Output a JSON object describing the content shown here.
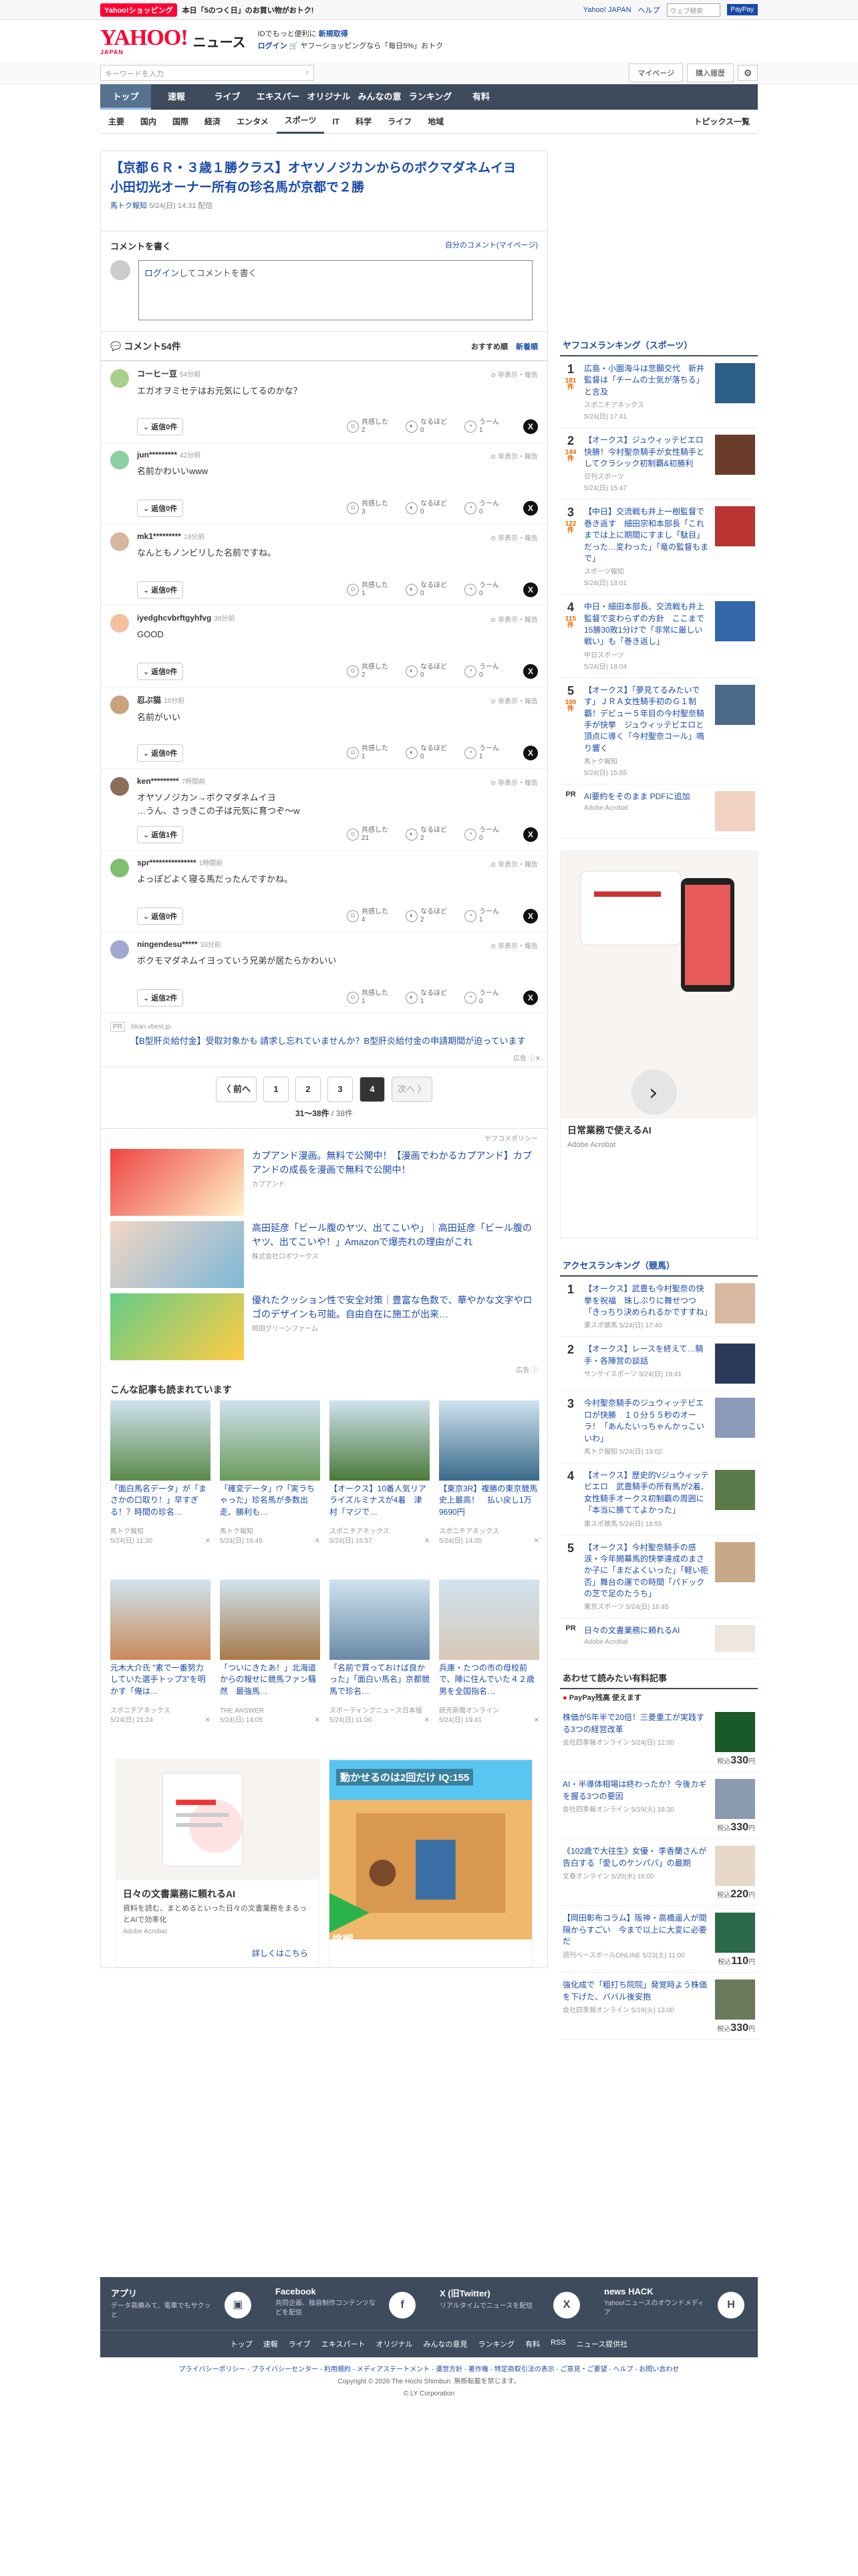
{
  "topbar": {
    "badge": "Yahoo!ショッピング",
    "promo": "本日「5のつく日」のお買い物がおトク!",
    "links": [
      "Yahoo! JAPAN",
      "ヘルプ"
    ],
    "search_placeholder": "ウェブ検索",
    "search_btn": "PayPay"
  },
  "header": {
    "logo": "YAHOO!",
    "logo_sub": "JAPAN",
    "news": "ニュース",
    "msg1": "IDでもっと便利に",
    "msg1b": "新規取得",
    "msg2a": "ログイン",
    "msg2": "ヤフーショッピングなら「毎日5%」おトク"
  },
  "search": {
    "placeholder": "キーワードを入力",
    "mypage": "マイページ",
    "history": "購入履歴"
  },
  "nav": [
    "トップ",
    "速報",
    "ライブ",
    "エキスパート",
    "オリジナル",
    "みんなの意見",
    "ランキング",
    "有料"
  ],
  "subnav": [
    "主要",
    "国内",
    "国際",
    "経済",
    "エンタメ",
    "スポーツ",
    "IT",
    "科学",
    "ライフ",
    "地域"
  ],
  "subnav_right": "トピックス一覧",
  "article": {
    "title": "【京都６Ｒ・３歳１勝クラス】オヤソノジカンからのボクマダネムイヨ　小田切光オーナー所有の珍名馬が京都で２勝",
    "source": "馬トク報知",
    "time": "5/24(日) 14:31 配信"
  },
  "comment_write": {
    "title": "コメントを書く",
    "mycomments": "自分のコメント(マイページ)",
    "login": "ログイン",
    "prompt": "してコメントを書く"
  },
  "comments_head": {
    "title": "コメント54件",
    "sort1": "おすすめ順",
    "sort2": "新着順"
  },
  "comments": [
    {
      "name": "コーヒー豆",
      "time": "54分前",
      "text": "エガオヲミセテはお元気にしてるのかな？",
      "reply": "返信0件",
      "c1": "2",
      "c2": "0",
      "c3": "1",
      "av": "#a7d08c"
    },
    {
      "name": "jun*********",
      "time": "42分前",
      "text": "名前かわいいwww",
      "reply": "返信0件",
      "c1": "3",
      "c2": "0",
      "c3": "0",
      "av": "#8ccfa0"
    },
    {
      "name": "mk1*********",
      "time": "19分前",
      "text": "なんともノンビリした名前ですね。",
      "reply": "返信0件",
      "c1": "1",
      "c2": "0",
      "c3": "0",
      "av": "#d6b6a0"
    },
    {
      "name": "iyedghcvbrftgyhfvg",
      "time": "39分前",
      "text": "GOOD",
      "reply": "返信0件",
      "c1": "2",
      "c2": "0",
      "c3": "0",
      "av": "#f2c1a0"
    },
    {
      "name": "忍ぶ猫",
      "time": "16分前",
      "text": "名前がいい",
      "reply": "返信0件",
      "c1": "1",
      "c2": "0",
      "c3": "1",
      "av": "#c9a27e"
    },
    {
      "name": "ken*********",
      "time": "7時間前",
      "text": "オヤソノジカン→ボクマダネムイヨ\n…うん、さっきこの子は元気に育つぞ〜w",
      "reply": "返信1件",
      "c1": "21",
      "c2": "2",
      "c3": "0",
      "av": "#8a6f5a"
    },
    {
      "name": "spr***************",
      "time": "1時間前",
      "text": "よっぽどよく寝る馬だったんですかね。",
      "reply": "返信0件",
      "c1": "4",
      "c2": "2",
      "c3": "1",
      "av": "#7fbf6f"
    },
    {
      "name": "ningendesu*****",
      "time": "33分前",
      "text": "ボクモマダネムイヨっていう兄弟が居たらかわいい",
      "reply": "返信2件",
      "c1": "1",
      "c2": "1",
      "c3": "0",
      "av": "#a0a8d0"
    }
  ],
  "comment_labels": {
    "report": "非表示・報告",
    "k1": "共感した",
    "k2": "なるほど",
    "k3": "うーん"
  },
  "pr": {
    "tag": "PR",
    "src": "bkan.vbest.jp",
    "text": "【B型肝炎給付金】受取対象かも 請求し忘れていませんか？B型肝炎給付金の申請期間が迫っています",
    "adinfo": "広告"
  },
  "pager": {
    "prev": "〈 前へ",
    "pages": [
      "1",
      "2",
      "3",
      "4"
    ],
    "current": "4",
    "next": "次へ 〉",
    "info": "31〜38件",
    "total": "/ 38件"
  },
  "policy": "ヤフコメポリシー",
  "ads": [
    {
      "title": "カプアンド漫画。無料で公開中！【漫画でわかるカプアンド】カプアンドの成長を漫画で無料で公開中！",
      "src": "カプアンド"
    },
    {
      "title": "高田延彦「ビール腹のヤツ、出てこいや」｜高田延彦「ビール腹のヤツ、出てこいや！」Amazonで爆売れの理由がこれ",
      "src": "株式会社ロボワークス"
    },
    {
      "title": "優れたクッション性で安全対策｜豊富な色数で、華やかな文字やロゴのデザインも可能。自由自在に施工が出来…",
      "src": "岡田グリーンファーム"
    }
  ],
  "ads_info": "広告",
  "also_read": {
    "title": "こんな記事も読まれています",
    "items": [
      {
        "title": "「面白馬名データ」が「まさかの口取り！」早すぎる！？時間の珍名…",
        "src": "馬トク報知",
        "time": "5/24(日) 11:30"
      },
      {
        "title": "「確変データ」!?「実ラちゃった」珍名馬が多数出走、勝利も…",
        "src": "馬トク報知",
        "time": "5/24(日) 16:45"
      },
      {
        "title": "【オークス】10番人気リアライズルミナスが4着　津村「マジで…",
        "src": "スポニチアネックス",
        "time": "5/24(日) 16:57"
      },
      {
        "title": "【東京3R】複勝の東京競馬史上最高！　払い戻し1万9690円",
        "src": "スポニチアネックス",
        "time": "5/24(日) 14:35"
      },
      {
        "title": "元木大介氏 \"素で一番努力していた選手トップ3\"を明かす「俺は…",
        "src": "スポニチアネックス",
        "time": "5/24(日) 21:24"
      },
      {
        "title": "「ついにきたあ！」北海道からの報せに競馬ファン騒然　最強馬…",
        "src": "THE ANSWER",
        "time": "5/24(日) 14:05"
      },
      {
        "title": "「名前で買っておけば良かった」「面白い馬名」京都競馬で珍名…",
        "src": "スポーティングニュース日本版",
        "time": "5/24(日) 11:00"
      },
      {
        "title": "兵庫・たつの市の母校前で、陣に住んでいた４２歳男を全国指名…",
        "src": "読売新聞オンライン",
        "time": "5/24(日) 19:41"
      }
    ]
  },
  "bottom_ads": [
    {
      "title": "日々の文書業務に頼れるAI",
      "desc": "資料を読む、まとめるといった日々の文書業務をまるっとAIで効率化",
      "src": "Adobe Acrobat",
      "link": "詳しくはこちら"
    },
    {
      "title": "動かせるのは2回だけ IQ:155",
      "badge": "挑戦"
    }
  ],
  "sidebar": {
    "ranking_title": "ヤフコメランキング（スポーツ）",
    "ranking": [
      {
        "n": "1",
        "c": "181",
        "title": "広島・小園海斗は悲願交代　新井監督は「チームの士気が落ちる」と言及",
        "src": "スポニチアネックス",
        "time": "5/24(日) 17:41"
      },
      {
        "n": "2",
        "c": "144",
        "title": "【オークス】ジュウィッテビエロ快勝！今村聖奈騎手が女性騎手としてクラシック初制覇&初勝利",
        "src": "日刊スポーツ",
        "time": "5/24(日) 15:47"
      },
      {
        "n": "3",
        "c": "122",
        "title": "【中日】交流戦も井上一樹監督で巻き返す　細田宗和本部長「これまでは上に期間にすまし「駄目」だった…変わった」「竜の監督もまで」",
        "src": "スポーツ報知",
        "time": "5/24(日) 18:01"
      },
      {
        "n": "4",
        "c": "115",
        "title": "中日・細田本部長、交流戦も井上監督で変わらずの方針　ここまで15勝30敗1分けで「非常に厳しい戦い」も「巻き返し」",
        "src": "中日スポーツ",
        "time": "5/24(日) 18:04"
      },
      {
        "n": "5",
        "c": "100",
        "title": "【オークス】「夢見てるみたいです」ＪＲＡ女性騎手初のＧ１制覇！デビュー５年目の今村聖奈騎手が快挙　ジュウィッテビエロと頂点に導く「今村聖奈コール」鳴り響く",
        "src": "馬トク報知",
        "time": "5/24(日) 15:55"
      }
    ],
    "ranking_pr": {
      "tag": "PR",
      "title": "AI要約をそのまま PDFに追加",
      "src": "Adobe Acrobat"
    },
    "side_ad": {
      "title": "日常業務で使えるAI",
      "src": "Adobe Acrobat"
    },
    "access_title": "アクセスランキング（競馬）",
    "access": [
      {
        "n": "1",
        "title": "【オークス】武豊も今村聖奈の快挙を祝福　珠しぶりに舞せつつ「きっちり決められるかですすね」",
        "src": "東スポ競馬",
        "time": "5/24(日) 17:40"
      },
      {
        "n": "2",
        "title": "【オークス】レースを終えて…騎手・各陣営の談話",
        "src": "サンケイスポーツ",
        "time": "5/24(日) 19:41"
      },
      {
        "n": "3",
        "title": "今村聖奈騎手のジュウィッテビエロが快勝　１０分５５秒のオーラ！「あんたいっちゃんかっこいいわ」",
        "src": "馬トク報知",
        "time": "5/24(日) 19:02"
      },
      {
        "n": "4",
        "title": "【オークス】歴史的Vジュウィッテビエロ　武豊騎手の所有馬が2着、女性騎手オークス初制覇の周囲に「本当に勝ててよかった」",
        "src": "東スポ競馬",
        "time": "5/24(日) 18:55"
      },
      {
        "n": "5",
        "title": "【オークス】今村聖奈騎手の感涙・今年開幕馬的快挙達成のまさか子に「まだよくいった」「軽い拒否」舞台の運での時間「パドックの芝で足のたうち」",
        "src": "東京スポーツ",
        "time": "5/24(日) 16:45"
      }
    ],
    "access_pr": {
      "tag": "PR",
      "title": "日々の文書業務に頼れるAI",
      "src": "Adobe Acrobat"
    },
    "paid_title": "あわせて読みたい有料記事",
    "paid_sub": "PayPay残高 使えます",
    "paid": [
      {
        "title": "株価が5年半で20倍！三菱重工が実践する3つの経営改革",
        "src": "会社四季報オンライン",
        "time": "5/24(日) 12:00",
        "price": "330"
      },
      {
        "title": "AI・半導体相場は終わったか？今後カギを握る3つの要因",
        "src": "会社四季報オンライン",
        "time": "5/19(火) 18:30",
        "price": "330"
      },
      {
        "title": "《102歳で大往生》女優・ 李香蘭さんが告白する「愛しのケンパパ」の最期",
        "src": "文春オンライン",
        "time": "5/20(水) 16:00",
        "price": "220"
      },
      {
        "title": "【岡田彰布コラム】阪神・高橋遥人が間隔からすごい　今まで以上に大変に必要だ",
        "src": "週刊ベースボールONLINE",
        "time": "5/23(土) 11:00",
        "price": "110"
      },
      {
        "title": "強化成で「粗打ち院院」発覚時よう株価を下げた、ババル後安抱",
        "src": "会社四季報オンライン",
        "time": "5/19(火) 13:00",
        "price": "330"
      }
    ],
    "price_label": "税込",
    "price_unit": "円"
  },
  "footer": {
    "cols": [
      {
        "t": "アプリ",
        "d": "データ高績みて、電車でもサクッと"
      },
      {
        "t": "Facebook",
        "d": "共同企画、独自制作コンテンツなどを配信"
      },
      {
        "t": "X (旧Twitter)",
        "d": "リアルタイムでニュースを配信"
      },
      {
        "t": "news HACK",
        "d": "Yahoo!ニュースのオウンドメディア"
      }
    ],
    "links": [
      "トップ",
      "速報",
      "ライブ",
      "エキスパート",
      "オリジナル",
      "みんなの意見",
      "ランキング",
      "有料",
      "RSS",
      "ニュース提供社"
    ],
    "legal": "プライバシーポリシー - プライバシーセンター - 利用規約 - メディアステートメント - 運営方針 - 著作権 - 特定商取引法の表示 - ご意見・ご要望 - ヘルプ - お問い合わせ",
    "copy1": "Copyright © 2026 The Hochi Shimbun. 無断転載を禁じます。",
    "copy2": "© LY Corporation"
  }
}
